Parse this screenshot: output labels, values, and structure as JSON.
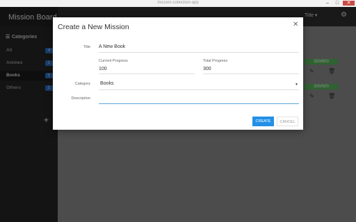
{
  "window": {
    "title": "mission-collection-app"
  },
  "app": {
    "title": "Mission Board"
  },
  "sidebar": {
    "heading": "Categories",
    "items": [
      {
        "label": "All",
        "count": "4"
      },
      {
        "label": "Animes",
        "count": "1"
      },
      {
        "label": "Books",
        "count": "1"
      },
      {
        "label": "Others",
        "count": "1"
      }
    ],
    "add_glyph": "+"
  },
  "header": {
    "sort_label": "Title"
  },
  "cards": [
    {
      "progress": "350/600"
    },
    {
      "progress": "300/500"
    }
  ],
  "dialog": {
    "title": "Create a New Mission",
    "title_label": "Title",
    "title_value": "A New Book",
    "current_label": "Current Progress",
    "current_value": "100",
    "total_label": "Total Progress",
    "total_value": "300",
    "category_label": "Category",
    "category_value": "Books",
    "description_label": "Description",
    "description_value": "",
    "create_label": "CREATE",
    "cancel_label": "CANCEL"
  }
}
